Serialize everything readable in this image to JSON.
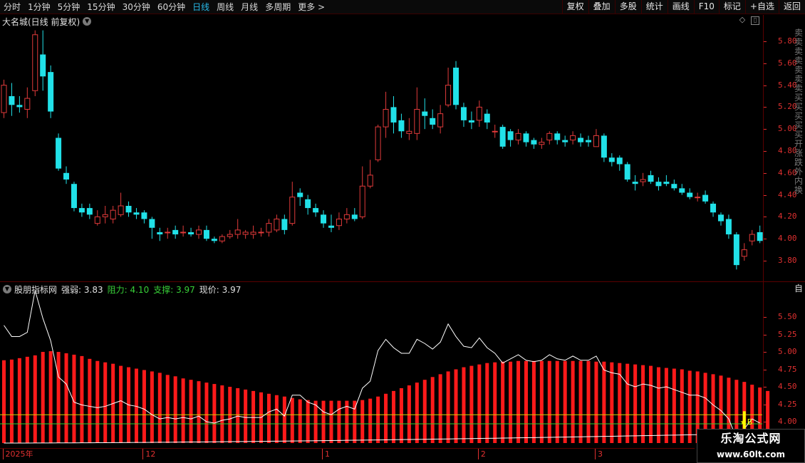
{
  "toolbar": {
    "period_tabs": [
      "分时",
      "1分钟",
      "5分钟",
      "15分钟",
      "30分钟",
      "60分钟",
      "日线",
      "周线",
      "月线",
      "多周期",
      "更多 >"
    ],
    "active_tab": "日线",
    "right_buttons": [
      "复权",
      "叠加",
      "多股",
      "统计",
      "画线",
      "F10",
      "标记",
      "+自选",
      "返回"
    ]
  },
  "main_chart": {
    "title": "大名城(日线 前复权)",
    "price_axis": [
      "5.80",
      "5.60",
      "5.40",
      "5.20",
      "5.00",
      "4.80",
      "4.60",
      "4.40",
      "4.20",
      "4.00",
      "3.80"
    ],
    "right_strip_text": "卖卖卖卖卖卖卖买买买买买开涨跌外内换"
  },
  "indicator": {
    "name": "股朋指标网",
    "strength_label": "强弱:",
    "strength_value": "3.83",
    "resistance_label": "阻力:",
    "resistance_value": "4.10",
    "support_label": "支撑:",
    "support_value": "3.97",
    "price_label": "现价:",
    "price_value": "3.97",
    "axis": [
      "5.50",
      "5.25",
      "5.00",
      "4.75",
      "4.50",
      "4.25",
      "4.00"
    ],
    "right_strip_text": "自",
    "marker_text": "B"
  },
  "date_axis": [
    "2025年",
    "12",
    "1",
    "2",
    "3"
  ],
  "watermark": {
    "title": "乐淘公式网",
    "url": "www.60lt.com"
  },
  "colors": {
    "up": "#e03a3a",
    "down": "#21e1e8",
    "bar": "#ff1a1a",
    "line": "#ffffff",
    "resistance": "#d8d000",
    "support": "#2fd02f"
  },
  "chart_data": [
    {
      "type": "candlestick",
      "title": "大名城(日线 前复权)",
      "ylim": [
        3.7,
        5.9
      ],
      "candles": [
        [
          5.15,
          5.4,
          5.45,
          5.1
        ],
        [
          5.3,
          5.22,
          5.42,
          5.12
        ],
        [
          5.22,
          5.2,
          5.3,
          5.15
        ],
        [
          5.18,
          5.28,
          5.38,
          5.1
        ],
        [
          5.35,
          5.86,
          5.9,
          5.3
        ],
        [
          5.68,
          5.48,
          5.9,
          5.35
        ],
        [
          5.52,
          5.16,
          5.58,
          5.1
        ],
        [
          4.92,
          4.64,
          4.96,
          4.62
        ],
        [
          4.6,
          4.54,
          4.66,
          4.5
        ],
        [
          4.5,
          4.28,
          4.52,
          4.25
        ],
        [
          4.28,
          4.24,
          4.32,
          4.2
        ],
        [
          4.28,
          4.22,
          4.32,
          4.18
        ],
        [
          4.14,
          4.2,
          4.26,
          4.12
        ],
        [
          4.2,
          4.22,
          4.3,
          4.14
        ],
        [
          4.18,
          4.26,
          4.3,
          4.14
        ],
        [
          4.22,
          4.3,
          4.42,
          4.2
        ],
        [
          4.3,
          4.24,
          4.34,
          4.2
        ],
        [
          4.24,
          4.22,
          4.28,
          4.18
        ],
        [
          4.24,
          4.18,
          4.26,
          4.14
        ],
        [
          4.18,
          4.1,
          4.2,
          4.0
        ],
        [
          4.06,
          4.04,
          4.1,
          3.98
        ],
        [
          4.06,
          4.06,
          4.1,
          4.0
        ],
        [
          4.08,
          4.04,
          4.12,
          4.0
        ],
        [
          4.06,
          4.06,
          4.12,
          4.02
        ],
        [
          4.06,
          4.04,
          4.1,
          4.02
        ],
        [
          4.04,
          4.08,
          4.12,
          4.0
        ],
        [
          4.08,
          4.0,
          4.12,
          3.98
        ],
        [
          4.0,
          3.98,
          4.02,
          3.96
        ],
        [
          3.98,
          4.02,
          4.04,
          3.96
        ],
        [
          4.02,
          4.04,
          4.08,
          4.0
        ],
        [
          4.04,
          4.08,
          4.18,
          4.0
        ],
        [
          4.04,
          4.06,
          4.08,
          4.0
        ],
        [
          4.04,
          4.06,
          4.12,
          4.0
        ],
        [
          4.06,
          4.06,
          4.1,
          4.02
        ],
        [
          4.06,
          4.14,
          4.18,
          4.02
        ],
        [
          4.08,
          4.18,
          4.22,
          4.06
        ],
        [
          4.18,
          4.08,
          4.22,
          4.04
        ],
        [
          4.14,
          4.38,
          4.52,
          4.12
        ],
        [
          4.42,
          4.38,
          4.46,
          4.3
        ],
        [
          4.36,
          4.28,
          4.4,
          4.22
        ],
        [
          4.28,
          4.24,
          4.32,
          4.2
        ],
        [
          4.22,
          4.14,
          4.26,
          4.1
        ],
        [
          4.12,
          4.1,
          4.22,
          4.06
        ],
        [
          4.12,
          4.18,
          4.24,
          4.08
        ],
        [
          4.18,
          4.22,
          4.28,
          4.14
        ],
        [
          4.22,
          4.18,
          4.28,
          4.16
        ],
        [
          4.2,
          4.48,
          4.66,
          4.18
        ],
        [
          4.48,
          4.58,
          4.72,
          4.46
        ],
        [
          4.72,
          5.02,
          5.04,
          4.7
        ],
        [
          5.02,
          5.18,
          5.34,
          4.92
        ],
        [
          5.2,
          5.06,
          5.3,
          4.96
        ],
        [
          5.08,
          4.98,
          5.14,
          4.92
        ],
        [
          4.96,
          4.98,
          5.1,
          4.9
        ],
        [
          4.96,
          5.18,
          5.38,
          4.9
        ],
        [
          5.16,
          5.12,
          5.28,
          5.0
        ],
        [
          5.1,
          5.04,
          5.18,
          5.0
        ],
        [
          5.02,
          5.14,
          5.22,
          4.96
        ],
        [
          5.22,
          5.4,
          5.56,
          5.2
        ],
        [
          5.56,
          5.22,
          5.62,
          5.18
        ],
        [
          5.2,
          5.08,
          5.24,
          5.02
        ],
        [
          5.08,
          5.06,
          5.16,
          5.0
        ],
        [
          5.08,
          5.2,
          5.26,
          5.02
        ],
        [
          5.14,
          5.06,
          5.18,
          5.0
        ],
        [
          4.98,
          4.98,
          5.04,
          4.92
        ],
        [
          5.02,
          4.84,
          5.04,
          4.82
        ],
        [
          4.98,
          4.9,
          5.0,
          4.84
        ],
        [
          4.9,
          4.96,
          5.0,
          4.86
        ],
        [
          4.96,
          4.88,
          4.98,
          4.84
        ],
        [
          4.9,
          4.86,
          4.92,
          4.82
        ],
        [
          4.86,
          4.88,
          4.92,
          4.82
        ],
        [
          4.9,
          4.96,
          4.98,
          4.86
        ],
        [
          4.96,
          4.9,
          4.98,
          4.86
        ],
        [
          4.9,
          4.88,
          4.94,
          4.84
        ],
        [
          4.9,
          4.94,
          4.98,
          4.86
        ],
        [
          4.92,
          4.88,
          4.96,
          4.84
        ],
        [
          4.9,
          4.88,
          4.94,
          4.84
        ],
        [
          4.84,
          4.94,
          5.0,
          4.84
        ],
        [
          4.94,
          4.74,
          4.96,
          4.7
        ],
        [
          4.74,
          4.7,
          4.78,
          4.66
        ],
        [
          4.74,
          4.68,
          4.76,
          4.62
        ],
        [
          4.68,
          4.54,
          4.7,
          4.52
        ],
        [
          4.52,
          4.5,
          4.58,
          4.44
        ],
        [
          4.52,
          4.54,
          4.6,
          4.48
        ],
        [
          4.58,
          4.52,
          4.62,
          4.5
        ],
        [
          4.52,
          4.48,
          4.56,
          4.44
        ],
        [
          4.52,
          4.5,
          4.58,
          4.48
        ],
        [
          4.5,
          4.46,
          4.54,
          4.44
        ],
        [
          4.46,
          4.42,
          4.5,
          4.4
        ],
        [
          4.42,
          4.38,
          4.46,
          4.36
        ],
        [
          4.38,
          4.38,
          4.42,
          4.34
        ],
        [
          4.4,
          4.34,
          4.44,
          4.32
        ],
        [
          4.32,
          4.24,
          4.34,
          4.2
        ],
        [
          4.22,
          4.16,
          4.24,
          4.12
        ],
        [
          4.18,
          4.04,
          4.22,
          4.0
        ],
        [
          4.04,
          3.76,
          4.06,
          3.72
        ],
        [
          3.84,
          3.9,
          3.96,
          3.8
        ],
        [
          3.98,
          4.04,
          4.08,
          3.94
        ],
        [
          4.06,
          3.98,
          4.12,
          3.96
        ]
      ]
    },
    {
      "type": "bar",
      "name": "股朋指标网",
      "ylim": [
        3.8,
        5.8
      ],
      "bar_values": [
        4.88,
        4.89,
        4.91,
        4.93,
        4.95,
        5.0,
        5.01,
        5.0,
        4.98,
        4.96,
        4.94,
        4.9,
        4.87,
        4.85,
        4.83,
        4.8,
        4.78,
        4.76,
        4.74,
        4.72,
        4.7,
        4.67,
        4.65,
        4.62,
        4.6,
        4.58,
        4.56,
        4.54,
        4.52,
        4.5,
        4.48,
        4.46,
        4.44,
        4.42,
        4.4,
        4.38,
        4.36,
        4.34,
        4.32,
        4.31,
        4.3,
        4.3,
        4.3,
        4.3,
        4.3,
        4.3,
        4.31,
        4.33,
        4.36,
        4.4,
        4.44,
        4.48,
        4.52,
        4.56,
        4.6,
        4.64,
        4.68,
        4.72,
        4.75,
        4.78,
        4.8,
        4.82,
        4.84,
        4.85,
        4.86,
        4.86,
        4.87,
        4.87,
        4.87,
        4.87,
        4.87,
        4.87,
        4.87,
        4.87,
        4.87,
        4.87,
        4.86,
        4.86,
        4.85,
        4.84,
        4.83,
        4.82,
        4.81,
        4.8,
        4.78,
        4.77,
        4.76,
        4.75,
        4.73,
        4.72,
        4.7,
        4.68,
        4.66,
        4.63,
        4.6,
        4.57,
        4.53,
        4.49,
        4.44
      ],
      "line_values": [
        5.38,
        5.22,
        5.22,
        5.28,
        5.88,
        5.48,
        5.16,
        4.64,
        4.54,
        4.28,
        4.24,
        4.22,
        4.2,
        4.22,
        4.26,
        4.3,
        4.24,
        4.22,
        4.18,
        4.1,
        4.04,
        4.06,
        4.04,
        4.06,
        4.04,
        4.08,
        4.0,
        3.98,
        4.02,
        4.04,
        4.08,
        4.06,
        4.06,
        4.06,
        4.14,
        4.18,
        4.08,
        4.38,
        4.38,
        4.28,
        4.24,
        4.14,
        4.1,
        4.18,
        4.22,
        4.18,
        4.48,
        4.58,
        5.02,
        5.18,
        5.06,
        4.98,
        4.98,
        5.18,
        5.12,
        5.04,
        5.14,
        5.4,
        5.22,
        5.08,
        5.06,
        5.2,
        5.06,
        4.98,
        4.84,
        4.9,
        4.96,
        4.88,
        4.86,
        4.88,
        4.96,
        4.9,
        4.88,
        4.94,
        4.88,
        4.88,
        4.94,
        4.74,
        4.7,
        4.68,
        4.54,
        4.5,
        4.54,
        4.52,
        4.48,
        4.5,
        4.46,
        4.42,
        4.38,
        4.38,
        4.34,
        4.24,
        4.16,
        4.04,
        3.76,
        3.9,
        4.04,
        3.98
      ],
      "resistance": 4.1,
      "support": 3.97
    }
  ]
}
